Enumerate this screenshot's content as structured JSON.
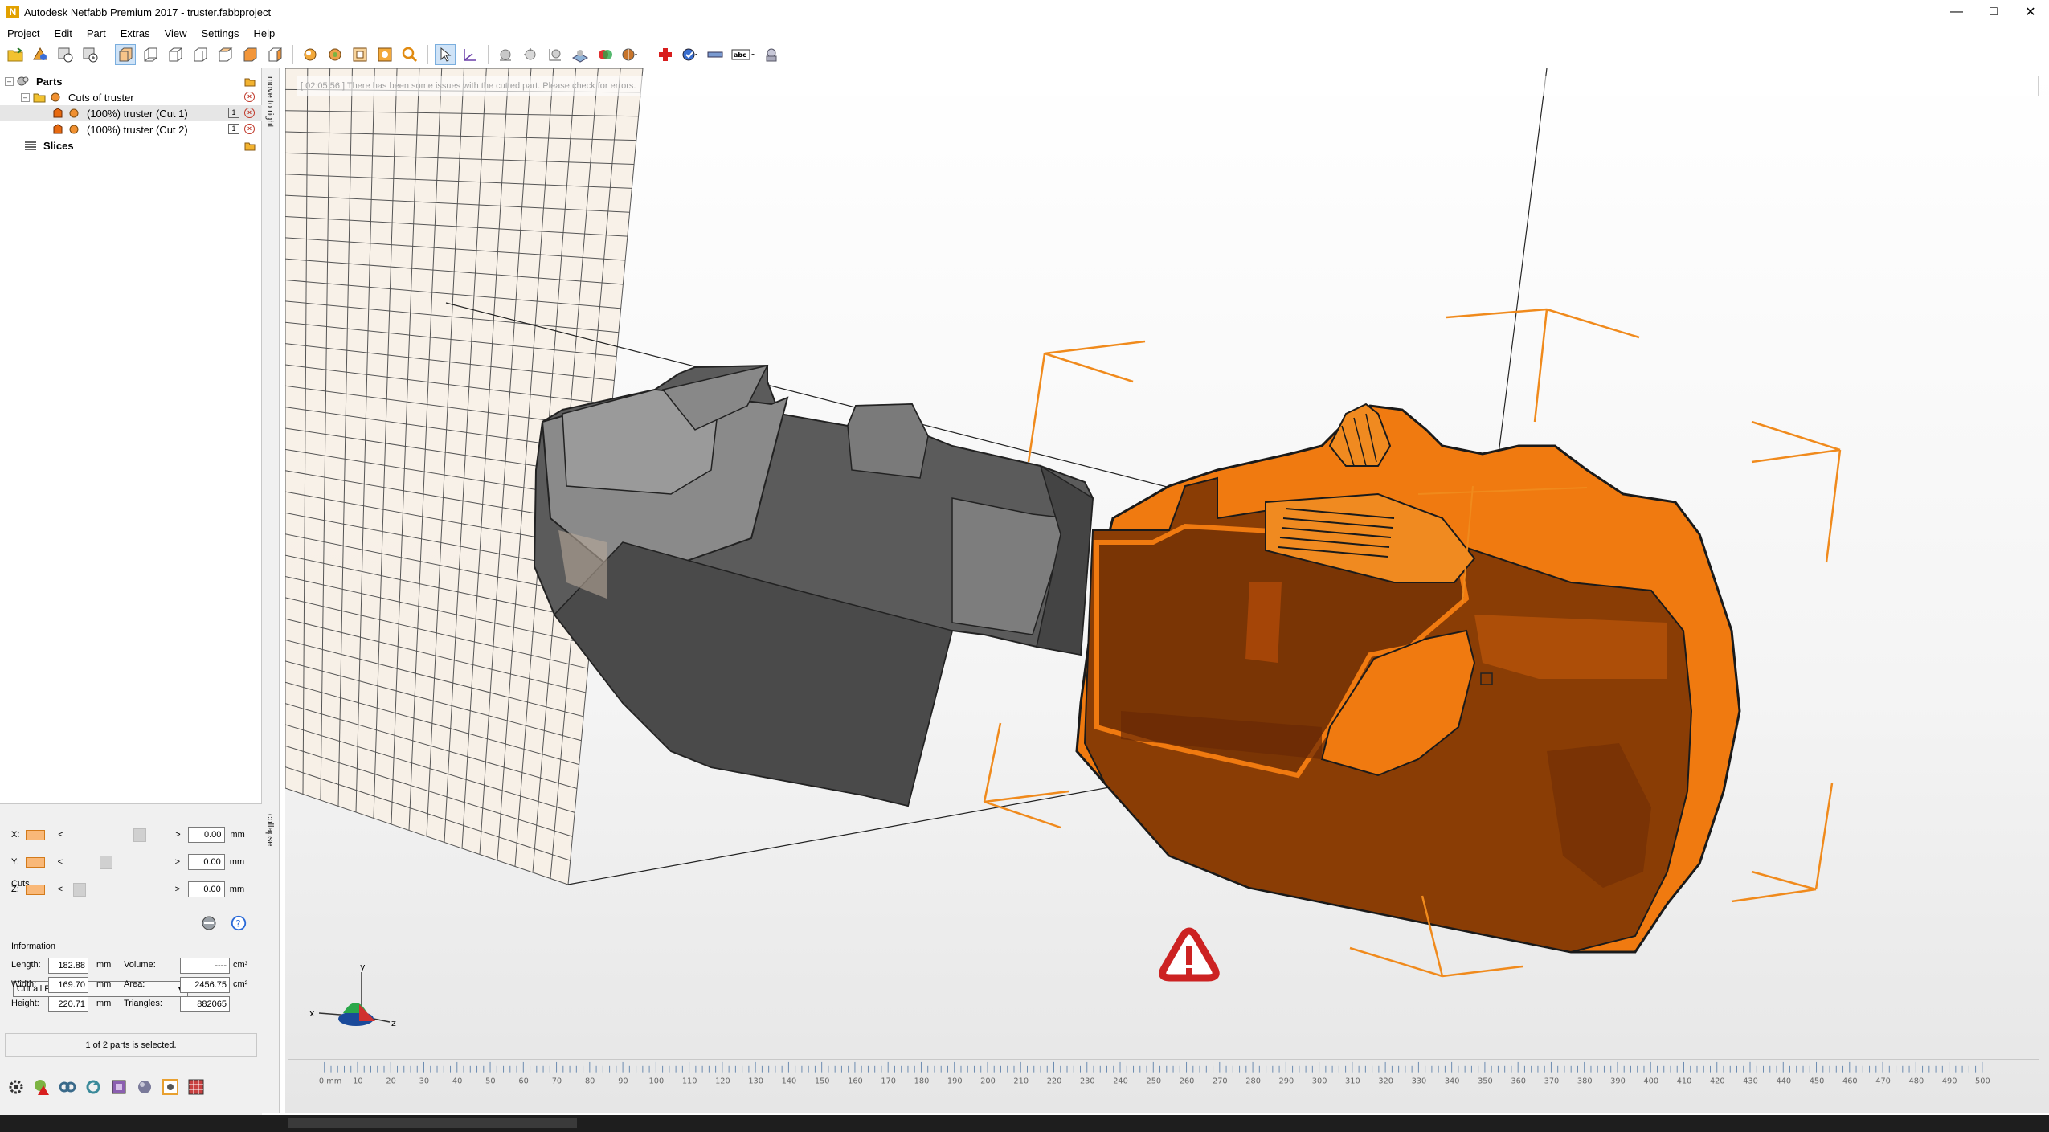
{
  "window": {
    "title": "Autodesk Netfabb Premium 2017 - truster.fabbproject",
    "logo_letter": "N"
  },
  "menu": [
    "Project",
    "Edit",
    "Part",
    "Extras",
    "View",
    "Settings",
    "Help"
  ],
  "tree": {
    "parts_label": "Parts",
    "group_label": "Cuts of truster",
    "items": [
      {
        "label": "(100%) truster (Cut 1)",
        "selected": true
      },
      {
        "label": "(100%) truster (Cut 2)",
        "selected": false
      }
    ],
    "slices_label": "Slices"
  },
  "side_strip": {
    "top_label": "move to right",
    "bottom_label": "collapse"
  },
  "cuts": {
    "title": "Cuts",
    "axes": [
      {
        "label": "X:",
        "value": "0.00",
        "unit": "mm",
        "position": 0.74
      },
      {
        "label": "Y:",
        "value": "0.00",
        "unit": "mm",
        "position": 0.35
      },
      {
        "label": "Z:",
        "value": "0.00",
        "unit": "mm",
        "position": 0.05
      }
    ],
    "prev_glyph": "<",
    "next_glyph": ">",
    "mode_select": "Cut all Parts"
  },
  "information": {
    "title": "Information",
    "length_label": "Length:",
    "length_value": "182.88",
    "width_label": "Width:",
    "width_value": "169.70",
    "height_label": "Height:",
    "height_value": "220.71",
    "dim_unit": "mm",
    "volume_label": "Volume:",
    "volume_value": "----",
    "volume_unit": "cm³",
    "area_label": "Area:",
    "area_value": "2456.75",
    "area_unit": "cm²",
    "triangles_label": "Triangles:",
    "triangles_value": "882065"
  },
  "status": {
    "selection": "1 of 2 parts is selected."
  },
  "viewport": {
    "message": "[ 02:05:56 ] There has been some issues with the cutted part. Please check for errors.",
    "ruler_unit_label": "0 mm",
    "ruler_ticks": [
      "10",
      "20",
      "30",
      "40",
      "50",
      "60",
      "70",
      "80",
      "90",
      "100",
      "110",
      "120",
      "130",
      "140",
      "150",
      "160",
      "170",
      "180",
      "190",
      "200",
      "210",
      "220",
      "230",
      "240",
      "250",
      "260",
      "270",
      "280",
      "290",
      "300",
      "310",
      "320",
      "330",
      "340",
      "350",
      "360",
      "370",
      "380",
      "390",
      "400",
      "410",
      "420",
      "430",
      "440",
      "450",
      "460",
      "470",
      "480",
      "490",
      "500"
    ],
    "axis_labels": {
      "x": "x",
      "y": "y",
      "z": "z"
    },
    "warning_icon": "warning-triangle-icon",
    "colors": {
      "selected_part": "#f07a10",
      "selected_part_dark": "#8a3d05",
      "unselected_part": "#555555",
      "bracket": "#f08a1c",
      "warning": "#cc2222"
    }
  }
}
